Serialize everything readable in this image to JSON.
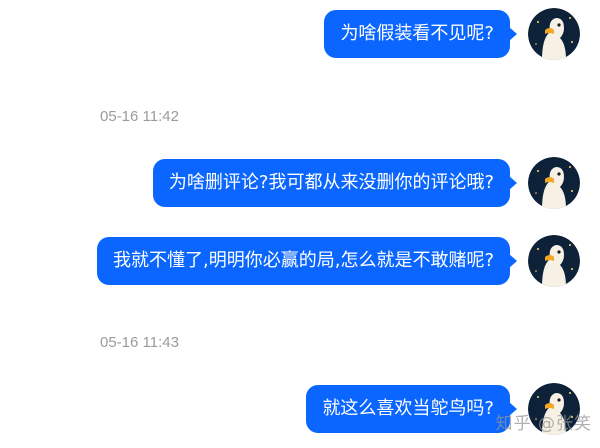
{
  "messages": [
    {
      "text": "为啥假装看不见呢?"
    },
    {
      "text": "为啥删评论?我可都从来没删你的评论哦?"
    },
    {
      "text": "我就不懂了,明明你必赢的局,怎么就是不敢赌呢?"
    },
    {
      "text": "就这么喜欢当鸵鸟吗?"
    }
  ],
  "timestamps": [
    "05-16 11:42",
    "05-16 11:43"
  ],
  "watermark": "知乎 @张笑",
  "colors": {
    "bubble": "#0a66ff",
    "timestamp": "#9b9b9b",
    "avatar_bg": "#0d2238"
  },
  "icons": {
    "avatar": "goose-avatar-icon"
  }
}
